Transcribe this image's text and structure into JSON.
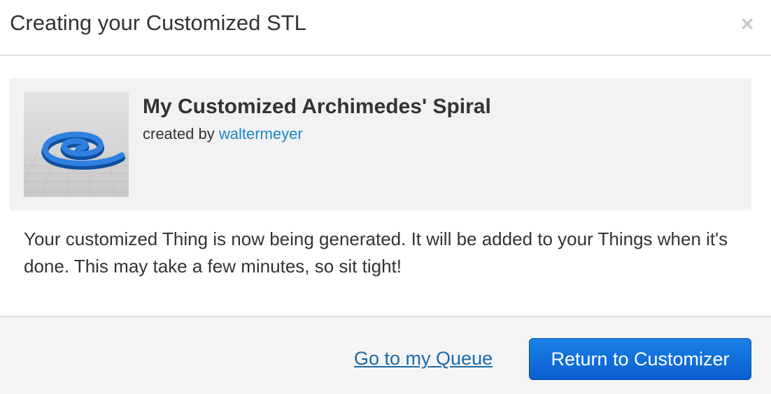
{
  "dialog": {
    "title": "Creating your Customized STL",
    "close_icon": "×"
  },
  "thing": {
    "title": "My Customized Archimedes' Spiral",
    "created_by_label": "created by",
    "author": "waltermeyer",
    "thumbnail": "spiral-model-thumbnail"
  },
  "message": "Your customized Thing is now being generated. It will be added to your Things when it's done. This may take a few minutes, so sit tight!",
  "footer": {
    "queue_link": "Go to my Queue",
    "return_button": "Return to Customizer"
  },
  "colors": {
    "link": "#1a86c8",
    "primary_button": "#0a5fd0",
    "card_background": "#f2f2f2",
    "footer_background": "#f5f5f5"
  }
}
